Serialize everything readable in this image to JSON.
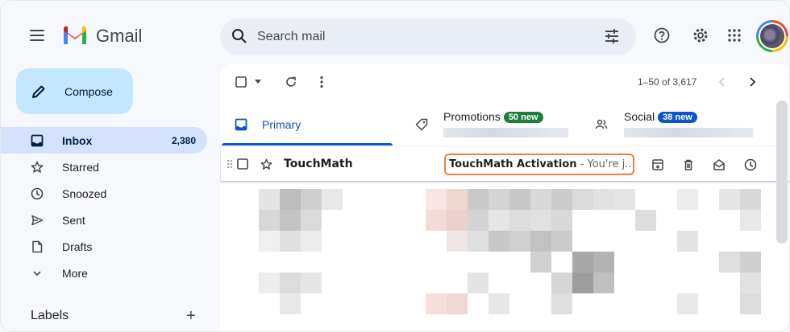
{
  "header": {
    "brand": "Gmail",
    "search_placeholder": "Search mail"
  },
  "sidebar": {
    "compose_label": "Compose",
    "items": [
      {
        "label": "Inbox",
        "count": "2,380",
        "icon": "inbox-icon"
      },
      {
        "label": "Starred",
        "count": "",
        "icon": "star-icon"
      },
      {
        "label": "Snoozed",
        "count": "",
        "icon": "clock-icon"
      },
      {
        "label": "Sent",
        "count": "",
        "icon": "send-icon"
      },
      {
        "label": "Drafts",
        "count": "",
        "icon": "draft-icon"
      },
      {
        "label": "More",
        "count": "",
        "icon": "chevron-down-icon"
      }
    ],
    "labels_heading": "Labels",
    "labels_add": "+"
  },
  "toolbar": {
    "page_info": "1–50 of 3,617"
  },
  "tabs": [
    {
      "label": "Primary",
      "badge": "",
      "icon": "inbox-icon"
    },
    {
      "label": "Promotions",
      "badge": "50 new",
      "badge_color": "#188038",
      "icon": "tag-icon"
    },
    {
      "label": "Social",
      "badge": "38 new",
      "badge_color": "#0b57d0",
      "icon": "people-icon"
    }
  ],
  "email": {
    "sender": "TouchMath",
    "subject": "TouchMath Activation",
    "snippet": " - You're j..."
  },
  "colors": {
    "accent": "#0b57d0",
    "compose_bg": "#c2e7ff",
    "highlight_border": "#e8813d"
  }
}
